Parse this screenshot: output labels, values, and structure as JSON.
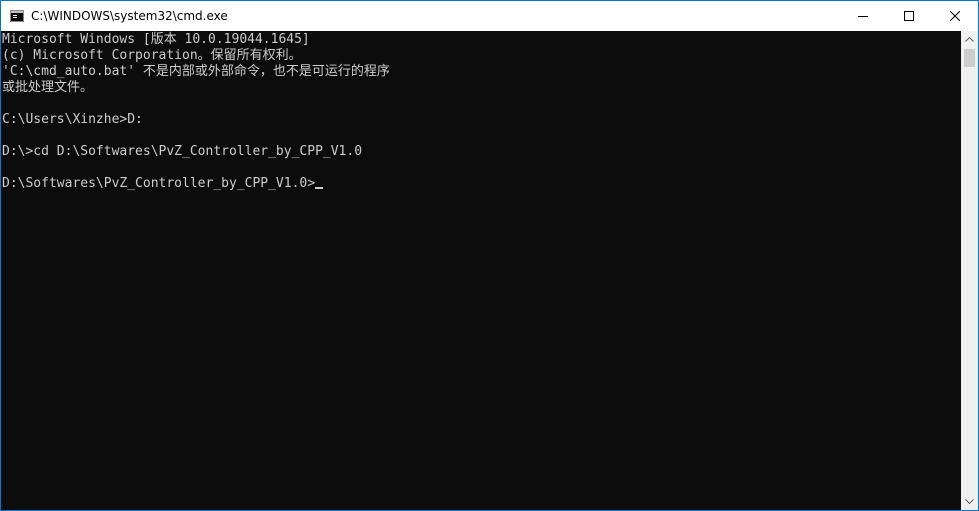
{
  "window": {
    "title": "C:\\WINDOWS\\system32\\cmd.exe",
    "app_icon": "cmd-console-icon",
    "border_color": "#0078d7"
  },
  "controls": {
    "minimize_icon": "minimize-icon",
    "maximize_icon": "maximize-icon",
    "close_icon": "close-icon"
  },
  "console": {
    "background": "#0c0c0c",
    "foreground": "#cccccc",
    "lines": [
      "Microsoft Windows [版本 10.0.19044.1645]",
      "(c) Microsoft Corporation。保留所有权利。",
      "'C:\\cmd_auto.bat' 不是内部或外部命令，也不是可运行的程序",
      "或批处理文件。",
      "",
      "C:\\Users\\Xinzhe>D:",
      "",
      "D:\\>cd D:\\Softwares\\PvZ_Controller_by_CPP_V1.0",
      "",
      "D:\\Softwares\\PvZ_Controller_by_CPP_V1.0>"
    ]
  },
  "scrollbar": {
    "up_icon": "scroll-up-arrow-icon",
    "down_icon": "scroll-down-arrow-icon"
  }
}
